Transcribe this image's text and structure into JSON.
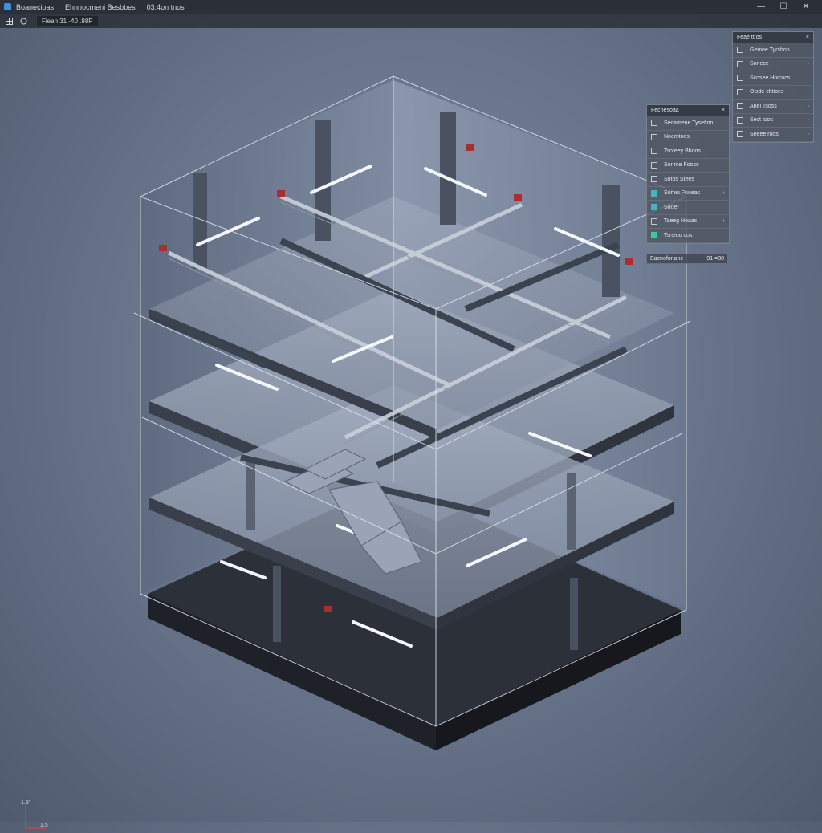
{
  "titlebar": {
    "items": [
      "Boanecioas",
      "Ehnnocmeni Besbbes",
      "03:4on tnos"
    ],
    "controls": [
      "—",
      "☐",
      "✕"
    ]
  },
  "toolbar": {
    "view_label": "Fiean 31 -40  .98P"
  },
  "panel_right": {
    "title": "Feae tt:os",
    "close": "×",
    "items": [
      {
        "label": "Gemee Tyrshon",
        "arrow": ""
      },
      {
        "label": "Sonece",
        "arrow": "›"
      },
      {
        "label": "Scosee Hoicocs",
        "arrow": ""
      },
      {
        "label": "Ocide chtioes",
        "arrow": ""
      },
      {
        "label": "Anei Tsoss",
        "arrow": "›"
      },
      {
        "label": "Sect toos",
        "arrow": "›"
      },
      {
        "label": "Seeee roos",
        "arrow": "›"
      }
    ]
  },
  "panel_left": {
    "title": "Fecnesoaa",
    "close": "×",
    "items": [
      {
        "label": "Secamene Tysetion",
        "arrow": "",
        "icon": ""
      },
      {
        "label": "Noemtoes",
        "arrow": "",
        "icon": ""
      },
      {
        "label": "Tsoteey Bhoos",
        "arrow": "",
        "icon": ""
      },
      {
        "label": "Sonroe Fooss",
        "arrow": "",
        "icon": ""
      },
      {
        "label": "Sotos Stees",
        "arrow": "",
        "icon": ""
      },
      {
        "label": "Somei Fnoeas",
        "arrow": "›",
        "icon": "teal"
      },
      {
        "label": "Sooer",
        "arrow": "",
        "icon": "teal"
      },
      {
        "label": "Taeeg Hoaas",
        "arrow": "›",
        "icon": ""
      },
      {
        "label": "Tsneoo cos",
        "arrow": "",
        "icon": "green"
      }
    ]
  },
  "status": {
    "label": "Eacnofonane",
    "value": "91 =30"
  },
  "axis": {
    "y_label": "1.5'",
    "x_label": "1.5"
  },
  "colors": {
    "accent": "#3b8fe0",
    "frame": "#dfe6f0",
    "pipe_red": "#a8302c"
  }
}
